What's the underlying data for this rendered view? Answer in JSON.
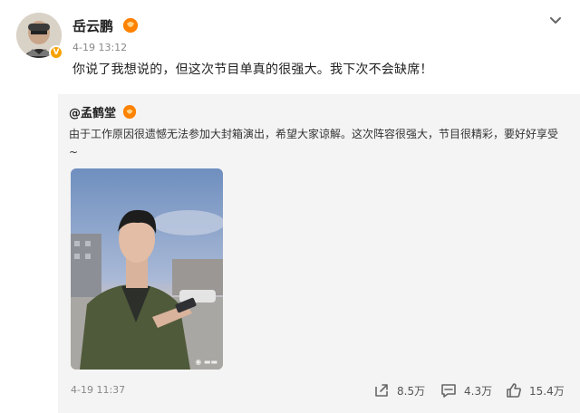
{
  "post": {
    "username": "岳云鹏",
    "timestamp": "4-19 13:12",
    "text": "你说了我想说的，但这次节目单真的很强大。我下次不会缺席！"
  },
  "repost": {
    "author": "@孟鹤堂",
    "text": "由于工作原因很遗憾无法参加大封箱演出，希望大家谅解。这次阵容很强大，节目很精彩，要好好享受~",
    "timestamp": "4-19 11:37",
    "stats": {
      "shares": "8.5万",
      "comments": "4.3万",
      "likes": "15.4万"
    }
  },
  "colors": {
    "badge": "#ff8200",
    "verified": "#f7a100"
  }
}
